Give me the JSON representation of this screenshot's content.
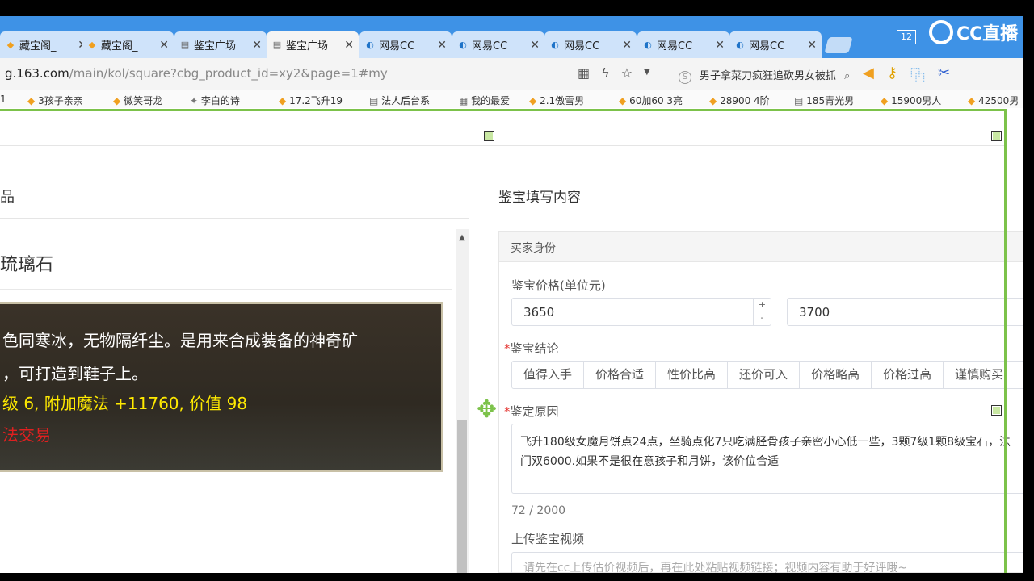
{
  "tabs": [
    {
      "label": "藏宝阁_",
      "icon": "treasure-icon",
      "active": false
    },
    {
      "label": "藏宝阁_",
      "icon": "treasure-icon",
      "active": false
    },
    {
      "label": "鉴宝广场",
      "icon": "page-icon",
      "active": false
    },
    {
      "label": "鉴宝广场",
      "icon": "page-icon",
      "active": true
    },
    {
      "label": "网易CC",
      "icon": "cc-icon",
      "active": false
    },
    {
      "label": "网易CC",
      "icon": "cc-icon",
      "active": false
    },
    {
      "label": "网易CC",
      "icon": "cc-icon",
      "active": false
    },
    {
      "label": "网易CC",
      "icon": "cc-icon",
      "active": false
    },
    {
      "label": "网易CC",
      "icon": "cc-icon",
      "active": false
    }
  ],
  "window": {
    "badge": "12",
    "brand": "CC直播"
  },
  "address": {
    "domain": "g.163.com",
    "path": "/main/kol/square?cbg_product_id=xy2&page=1#my",
    "search_text": "男子拿菜刀疯狂追砍男女被抓"
  },
  "bookmarks": [
    "1",
    "3孩子亲亲",
    "微笑哥龙",
    "李白的诗",
    "17.2飞升19",
    "法人后台系",
    "我的最爱",
    "2.1傲雪男",
    "60加60 3亮",
    "28900 4阶",
    "185青光男",
    "15900男人",
    "42500男"
  ],
  "left": {
    "section_title": "品",
    "item_title": "琉璃石",
    "desc_lines": [
      "色同寒冰，无物隔纤尘。是用来合成装备的神奇矿",
      "，可打造到鞋子上。"
    ],
    "stat_line": "级 6, 附加魔法 +11760, 价值 98",
    "trade_line": "法交易"
  },
  "right": {
    "section_title": "鉴宝填写内容",
    "panel_header": "买家身份",
    "price_label": "鉴宝价格(单位元)",
    "price_min": "3650",
    "price_max": "3700",
    "conclusion_label": "鉴宝结论",
    "conclusions": [
      "值得入手",
      "价格合适",
      "性价比高",
      "还价可入",
      "价格略高",
      "价格过高",
      "谨慎购买"
    ],
    "reason_label": "鉴定原因",
    "reason_text": "飞升180级女魔月饼点24点，坐骑点化7只吃满胫骨孩子亲密小心低一些，3颗7级1颗8级宝石，法门双6000.如果不是很在意孩子和月饼，该价位合适",
    "counter": "72 / 2000",
    "video_label": "上传鉴宝视频",
    "video_placeholder": "请先在cc上传估价视频后，再在此处粘贴视频链接；视频内容有助于好评哦~"
  },
  "colors": {
    "tab_bar": "#3e92e6",
    "selection": "#7cc24a",
    "stat_yellow": "#ffea00",
    "trade_red": "#e02020"
  }
}
